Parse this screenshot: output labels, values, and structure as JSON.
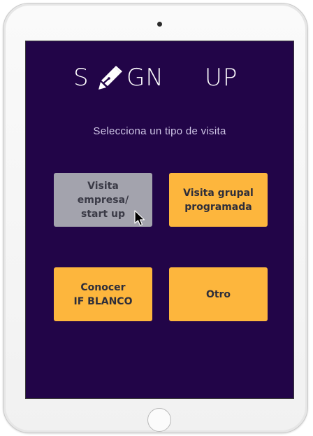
{
  "app": {
    "title_parts": [
      "S",
      "GN",
      "UP"
    ],
    "title_icon": "pen-icon",
    "subtitle": "Selecciona un tipo de visita"
  },
  "options": [
    {
      "label": "Visita\nempresa/\nstart up",
      "state": "hovered",
      "color": "#a3a3ad"
    },
    {
      "label": "Visita grupal\nprogramada",
      "state": "default",
      "color": "#fdb63d"
    },
    {
      "label": "Conocer\nIF BLANCO",
      "state": "default",
      "color": "#fdb63d"
    },
    {
      "label": "Otro",
      "state": "default",
      "color": "#fdb63d"
    }
  ],
  "colors": {
    "screen_background": "#220548",
    "accent": "#fdb63d",
    "hover": "#a3a3ad",
    "title_text": "#ffffff",
    "subtitle_text": "#cfc6e6"
  },
  "icons": {
    "cursor": "cursor-arrow-icon",
    "camera": "camera-icon",
    "home": "home-button"
  }
}
